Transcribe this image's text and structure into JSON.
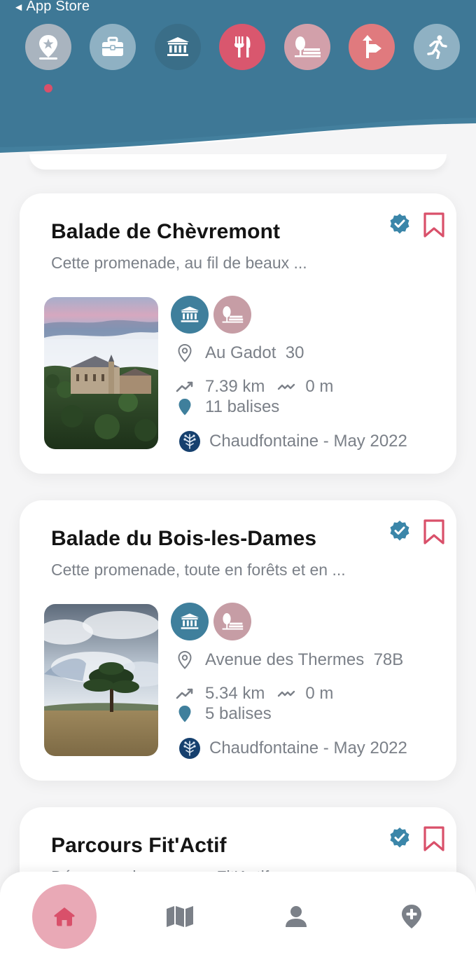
{
  "status_bar": {
    "back_label": "App Store"
  },
  "categories": [
    {
      "icon": "map-pin-star-icon",
      "color": "#a9b4bf",
      "selected": true
    },
    {
      "icon": "briefcase-icon",
      "color": "#8fb1c3"
    },
    {
      "icon": "museum-icon",
      "color": "#3a6e88"
    },
    {
      "icon": "restaurant-icon",
      "color": "#d9576e"
    },
    {
      "icon": "bench-park-icon",
      "color": "#d2a0aa"
    },
    {
      "icon": "direction-sign-icon",
      "color": "#e07a7e"
    },
    {
      "icon": "running-person-icon",
      "color": "#8fb1c3"
    }
  ],
  "walks": [
    {
      "title": "Balade de Chèvremont",
      "description": "Cette promenade, au fil de beaux ...",
      "address": "Au Gadot  30",
      "distance": "7.39 km",
      "elevation": "0 m",
      "markers": "11 balises",
      "organizer": "Chaudfontaine - May 2022",
      "tags": [
        "museum-icon",
        "bench-park-icon"
      ],
      "verified": true,
      "image": "foggy-valley-castle"
    },
    {
      "title": "Balade du Bois-les-Dames",
      "description": "Cette promenade, toute en forêts et en ...",
      "address": "Avenue des Thermes  78B",
      "distance": "5.34 km",
      "elevation": "0 m",
      "markers": "5 balises",
      "organizer": "Chaudfontaine - May 2022",
      "tags": [
        "museum-icon",
        "bench-park-icon"
      ],
      "verified": true,
      "image": "pine-tree-meadow"
    },
    {
      "title": "Parcours Fit'Actif",
      "description": "Découvrez le parcours Fit'Actif ...",
      "verified": true
    }
  ],
  "bottom_nav": [
    {
      "name": "home",
      "icon": "home-icon",
      "active": true
    },
    {
      "name": "map",
      "icon": "map-icon"
    },
    {
      "name": "profile",
      "icon": "user-icon"
    },
    {
      "name": "add-place",
      "icon": "pin-plus-icon"
    }
  ],
  "colors": {
    "header_blue": "#437f9d",
    "accent_pink": "#d9506a",
    "verified_blue": "#3b86a9",
    "text_grey": "#7b8088"
  }
}
